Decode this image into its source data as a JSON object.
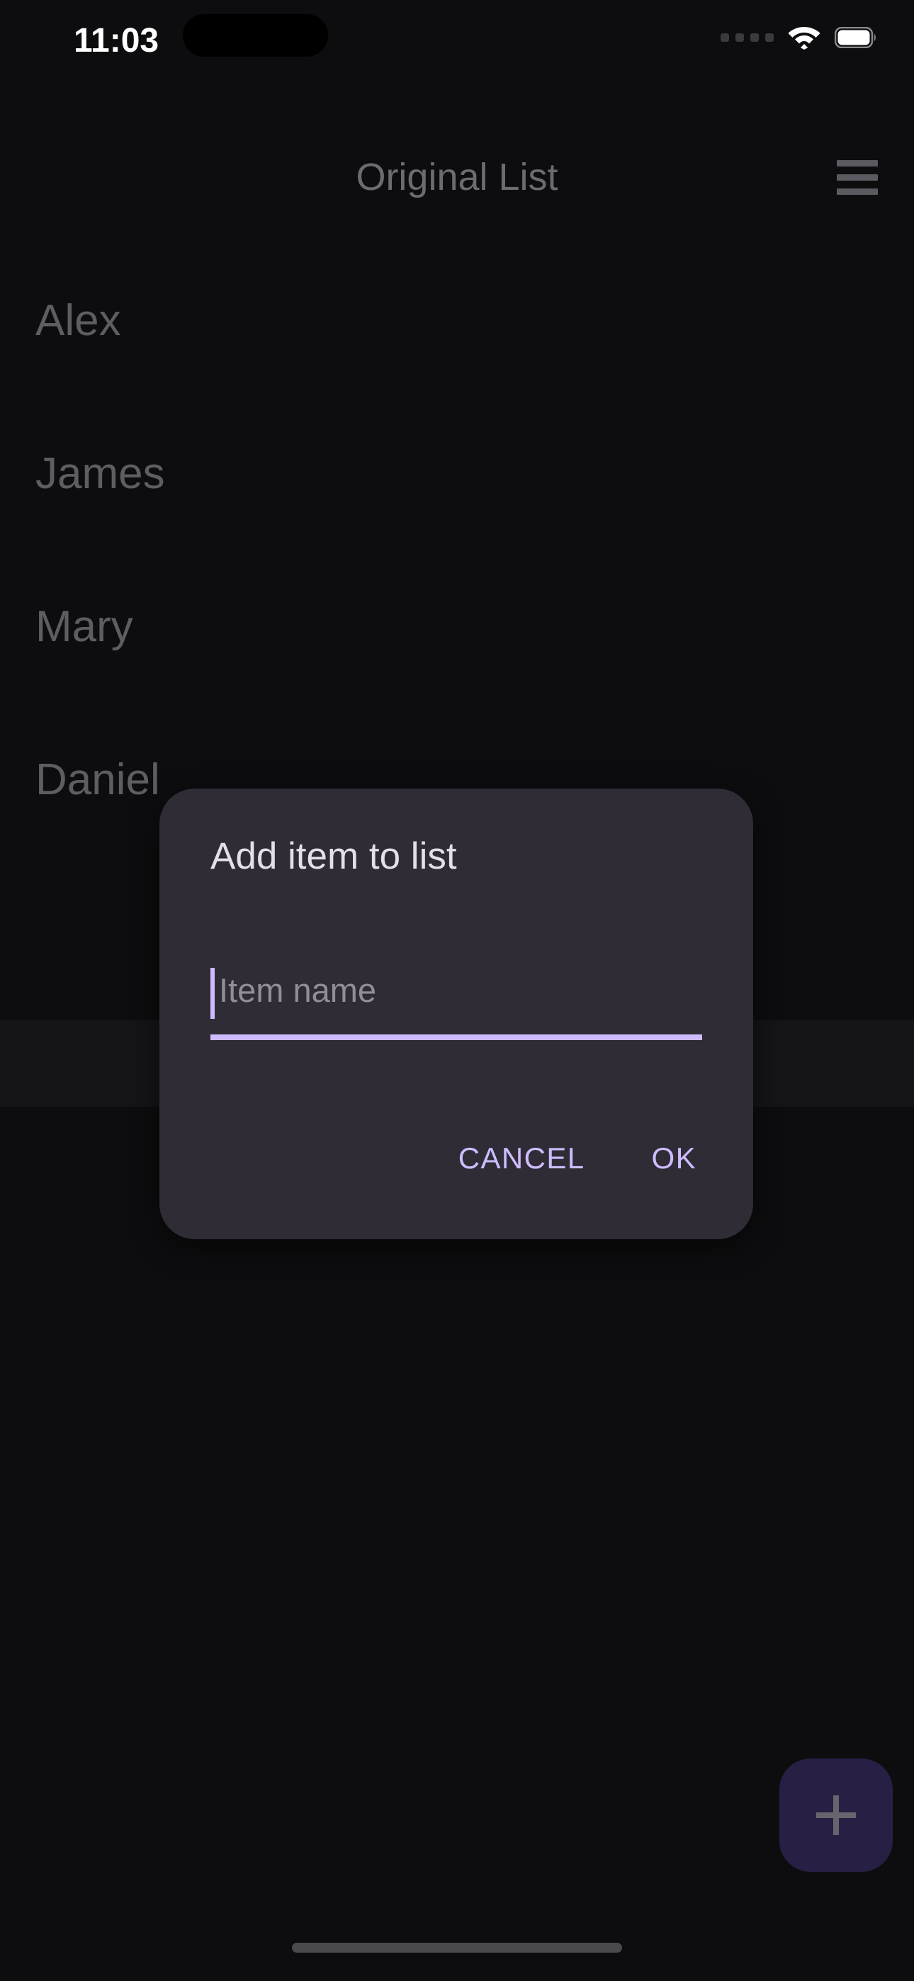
{
  "status_bar": {
    "time": "11:03",
    "cellular_icon": "cellular-dots-icon",
    "wifi_icon": "wifi-icon",
    "battery_icon": "battery-full-icon"
  },
  "app_bar": {
    "title": "Original List",
    "menu_icon": "hamburger-menu-icon"
  },
  "list": {
    "items": [
      {
        "label": "Alex"
      },
      {
        "label": "James"
      },
      {
        "label": "Mary"
      },
      {
        "label": "Daniel"
      }
    ]
  },
  "fab": {
    "icon": "plus-icon",
    "label": "+"
  },
  "dialog": {
    "title": "Add item to list",
    "input": {
      "value": "",
      "placeholder": "Item name"
    },
    "cancel_label": "CANCEL",
    "ok_label": "OK"
  },
  "colors": {
    "background": "#0D0D0F",
    "dialog_surface": "#2F2C36",
    "accent_purple": "#CFBCFF",
    "fab_surface": "#272044",
    "dim_text": "#5E5E62",
    "title_text": "#6C6C70",
    "dialog_title_text": "#E4E0E8",
    "placeholder_text": "#928E99"
  }
}
